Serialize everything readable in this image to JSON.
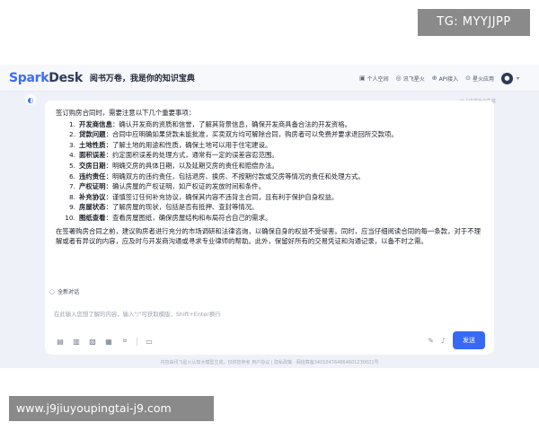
{
  "watermarks": {
    "top_right": "TG: MYYJJPP",
    "bottom_left": "www.j9jiuyoupingtai-j9.com"
  },
  "header": {
    "brand_prefix": "Spark",
    "brand_suffix": "Desk",
    "slogan": "阅书万卷，我是你的知识宝典",
    "nav": [
      {
        "label": "个人空间",
        "icon": "person-space-icon"
      },
      {
        "label": "讯飞星火",
        "icon": "spark-icon"
      },
      {
        "label": "API接入",
        "icon": "api-icon"
      },
      {
        "label": "星火应用",
        "icon": "apps-icon"
      }
    ],
    "avatar_icon": "user-avatar-icon"
  },
  "chat": {
    "ai_note": "以上内容为AI生成",
    "intro": "签订购房合同时，需要注意以下几个重要事项：",
    "items": [
      {
        "num": "1.",
        "term": "开发商信息",
        "text": "：确认开发商的资质和信誉，了解其背景信息，确保开发商具备合法的开发资格。"
      },
      {
        "num": "2.",
        "term": "贷款问题",
        "text": "：合同中应明确如果贷款未能批准，买卖双方均可解除合同，购房者可以免费并要求退回所交款项。"
      },
      {
        "num": "3.",
        "term": "土地性质",
        "text": "：了解土地的用途和性质，确保土地可以用于住宅建设。"
      },
      {
        "num": "4.",
        "term": "面积误差",
        "text": "：约定面积误差的处理方式，通常有一定的误差容忍范围。"
      },
      {
        "num": "5.",
        "term": "交房日期",
        "text": "：明确交房的具体日期，以及延期交房的责任和赔偿办法。"
      },
      {
        "num": "6.",
        "term": "违约责任",
        "text": "：明确双方的违约责任，包括退房、换房、不按期付款或交房等情况的责任和处理方式。"
      },
      {
        "num": "7.",
        "term": "产权证明",
        "text": "：确认房屋的产权证明，如产权证的发放时间和条件。"
      },
      {
        "num": "8.",
        "term": "补充协议",
        "text": "：谨慎签订任何补充协议，确保其内容不违背主合同，且有利于保护自身权益。"
      },
      {
        "num": "9.",
        "term": "房屋状态",
        "text": "：了解房屋的现状，包括是否有抵押、查封等情况。"
      },
      {
        "num": "10.",
        "term": "图纸查看",
        "text": "：查看房屋图纸，确保房屋结构和布局符合自己的需求。"
      }
    ],
    "summary": "在签署购房合同之前，建议购房者进行充分的市场调研和法律咨询，以确保自身的权益不受侵害。同时，应当仔细阅读合同的每一条款，对于不理解或者有异议的内容，应及时与开发商沟通或寻求专业律师的帮助。此外，保留好所有的交易凭证和沟通记录，以备不时之需。",
    "new_chat_label": "全新对话"
  },
  "composer": {
    "placeholder": "在此输入您想了解的内容，输入\"/\"可获取模版，Shift+Enter换行",
    "tools": [
      "doc-icon",
      "file-icon",
      "image-icon",
      "screenshot-icon",
      "scan-icon",
      "folder-icon"
    ],
    "send_label": "发送"
  },
  "footer": {
    "text": "内容由讯飞星火认知大模型生成，仅供您参考    用户协议  |  隐私政策 · 网信算备340104764864601230021号"
  }
}
